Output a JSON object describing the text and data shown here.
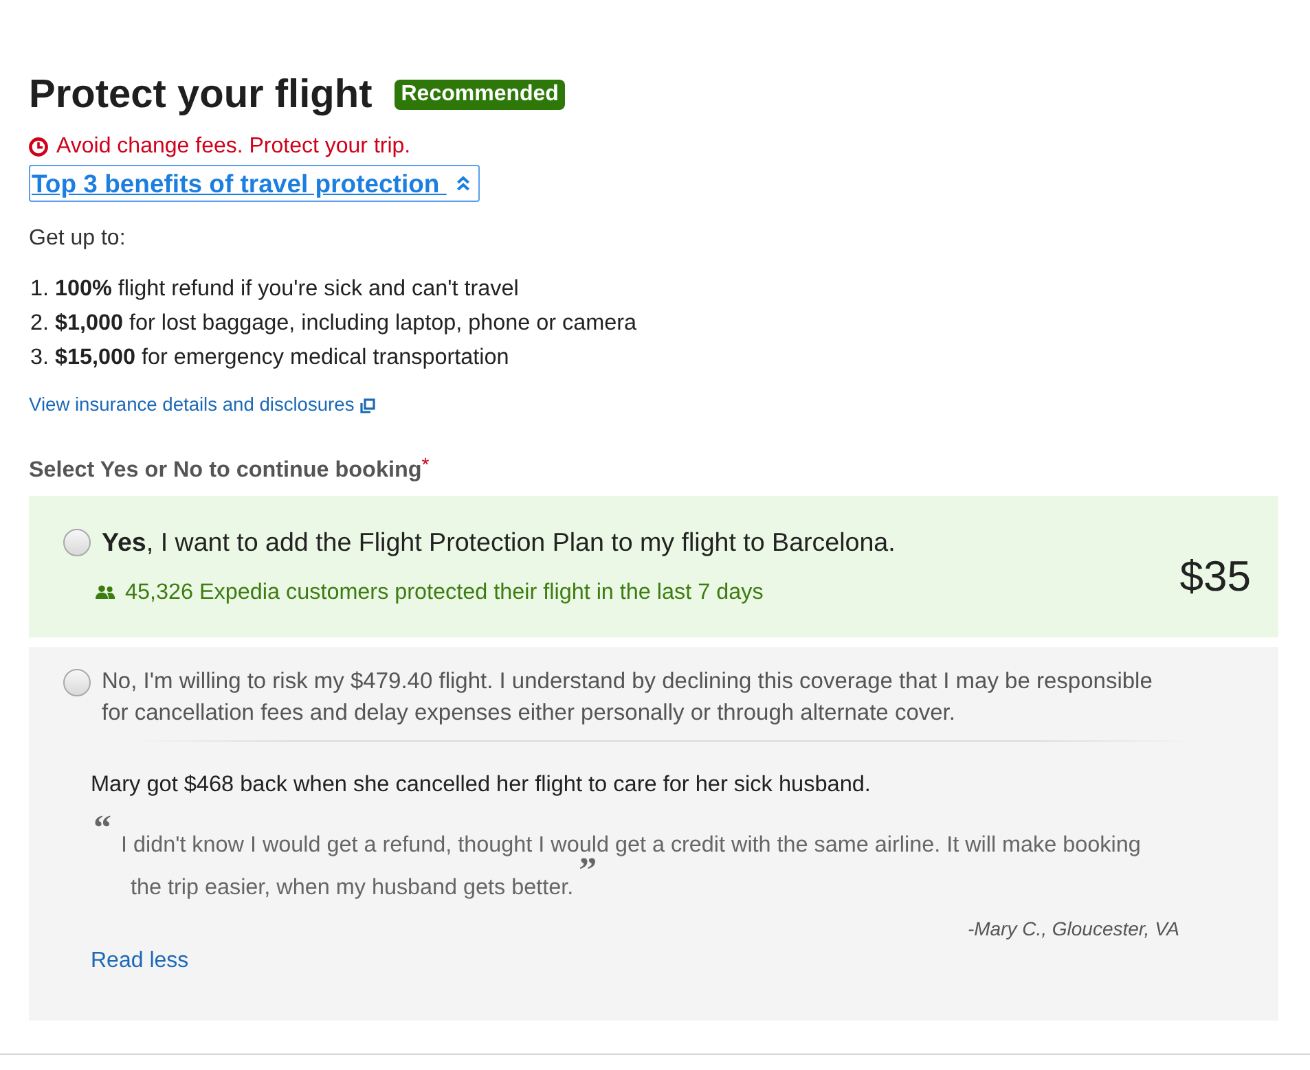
{
  "header": {
    "title": "Protect your flight",
    "badge": "Recommended"
  },
  "alert": {
    "text": "Avoid change fees. Protect your trip."
  },
  "benefits": {
    "toggle_label": "Top 3 benefits of travel protection",
    "expanded": true,
    "intro": "Get up to:",
    "items": [
      "1. **100%** flight refund if you're sick and can't travel",
      "2. **$1,000** for lost baggage, including laptop, phone or camera",
      "3. **$15,000** for emergency medical transportation"
    ]
  },
  "details_link": "View insurance details and disclosures",
  "question": {
    "label": "Select Yes or No to continue booking",
    "required_mark": "*"
  },
  "options": [
    {
      "kind": "yes",
      "selected": false,
      "text": "**Yes**, I want to add the Flight Protection Plan to my flight to Barcelona.",
      "note": "45,326 Expedia customers protected their flight in the last 7 days",
      "price": "$35"
    },
    {
      "kind": "no",
      "selected": false,
      "text": "No, I'm willing to risk my $479.40 flight. I understand by declining this coverage that I may be responsible for cancellation fees and delay expenses either personally or through alternate cover.",
      "testimonial": {
        "summary": "Mary got $468 back when she cancelled her flight to care for her sick husband.",
        "open_quote": "“",
        "quote": "I didn't know I would get a refund, thought I would get a credit with the same airline. It will make booking the trip easier, when my husband gets better.",
        "close_quote": "”",
        "author": "-Mary C., Gloucester, VA"
      },
      "read_toggle": "Read less"
    }
  ]
}
